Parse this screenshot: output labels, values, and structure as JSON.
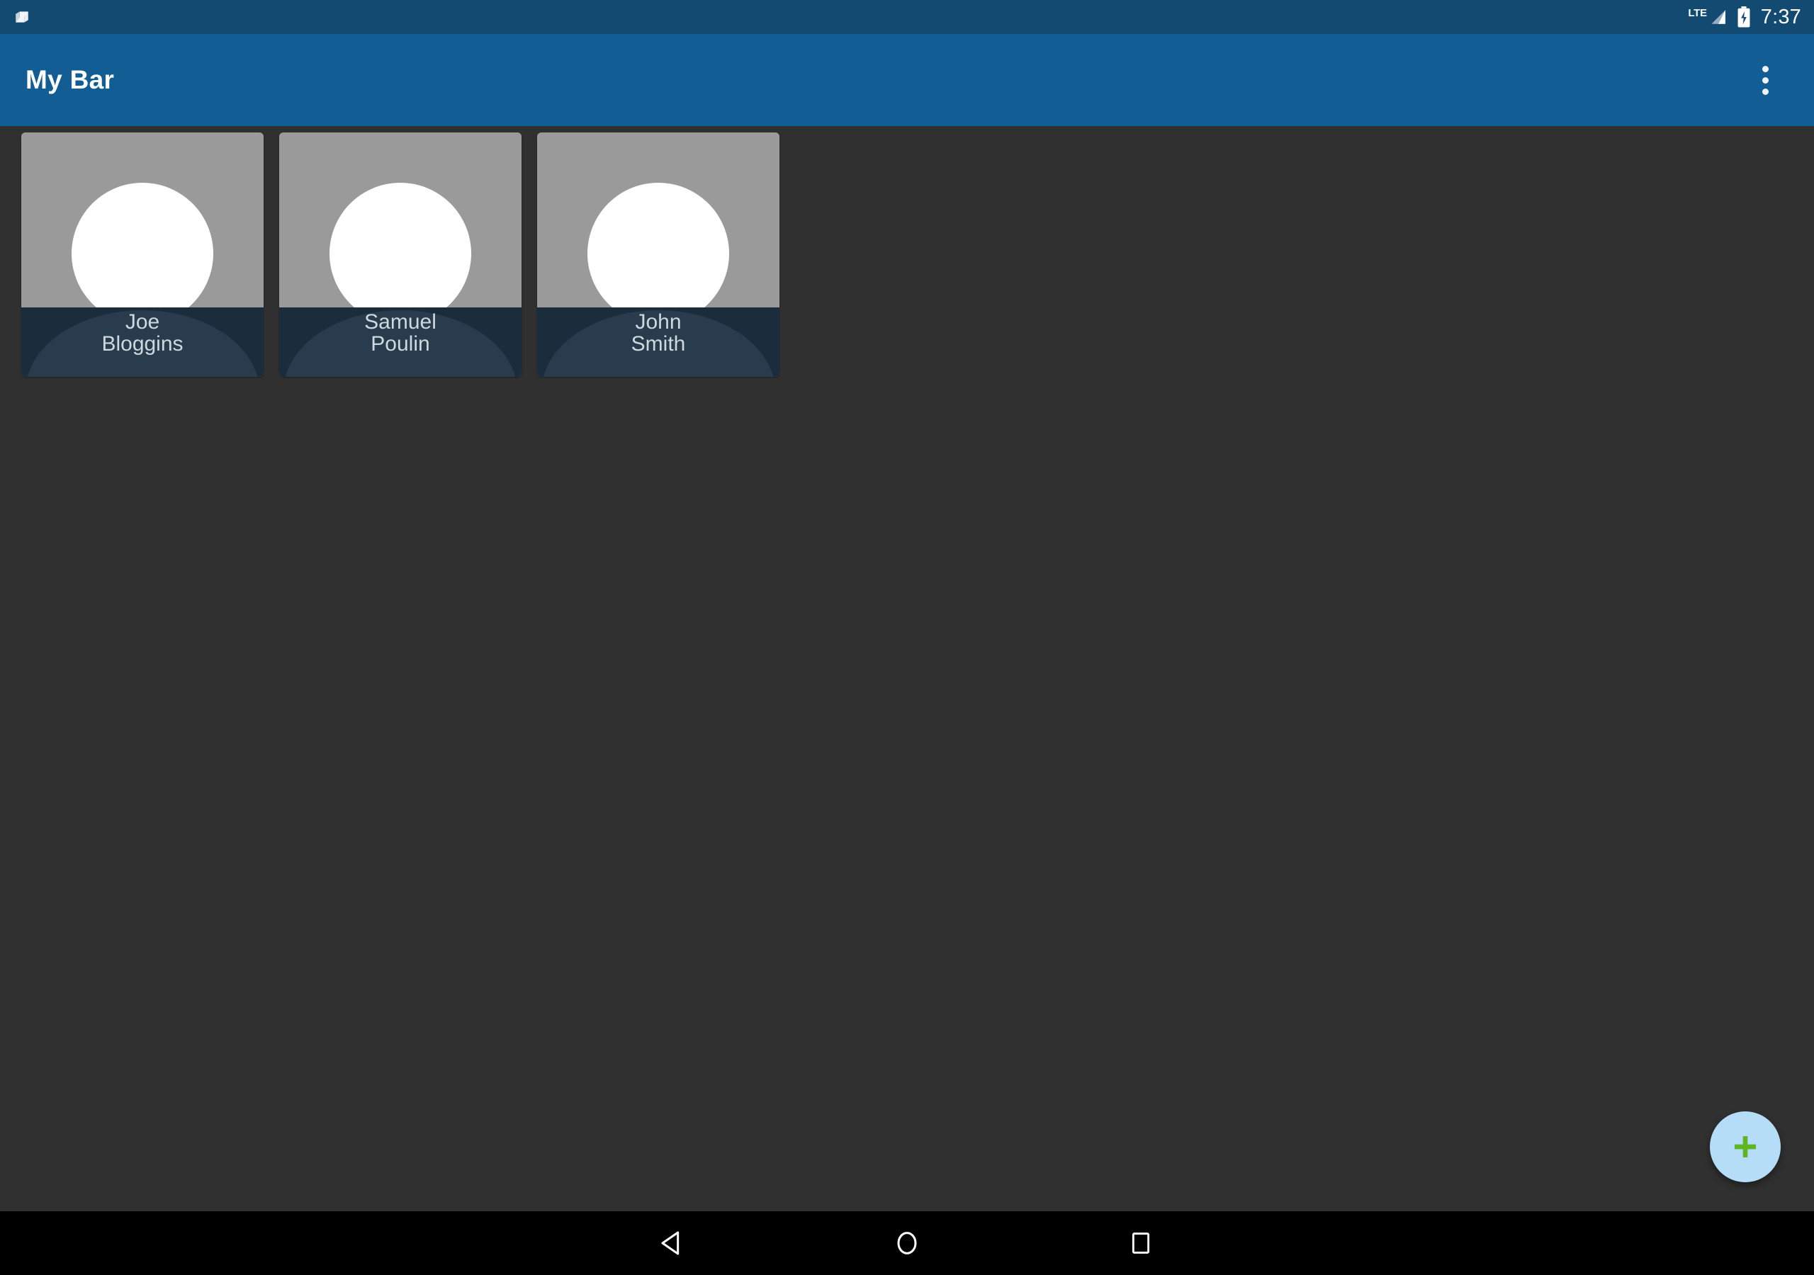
{
  "status_bar": {
    "notification_icon": "nougat-easter-egg-icon",
    "network_label": "LTE",
    "signal_icon": "signal-bars-icon",
    "battery_icon": "battery-charging-icon",
    "time": "7:37",
    "background_color": "#134a72"
  },
  "app_bar": {
    "title": "My Bar",
    "overflow_icon": "more-vert-icon",
    "background_color": "#125d94"
  },
  "main": {
    "background_color": "#303030",
    "people": [
      {
        "first_name": "Joe",
        "last_name": "Bloggins",
        "avatar_icon": "person-placeholder-icon"
      },
      {
        "first_name": "Samuel",
        "last_name": "Poulin",
        "avatar_icon": "person-placeholder-icon"
      },
      {
        "first_name": "John",
        "last_name": "Smith",
        "avatar_icon": "person-placeholder-icon"
      }
    ],
    "card_photo_color": "#9a9a9a",
    "card_footer_color": "#1b2c3c",
    "card_shoulder_color": "#283c4d",
    "name_text_color": "#cfd8dd"
  },
  "fab": {
    "icon": "plus-icon",
    "background_color": "#b6ddf7",
    "icon_color": "#5fb522"
  },
  "nav_bar": {
    "background_color": "#000000",
    "buttons": [
      {
        "icon": "back-triangle-icon"
      },
      {
        "icon": "home-circle-icon"
      },
      {
        "icon": "recents-square-icon"
      }
    ]
  }
}
